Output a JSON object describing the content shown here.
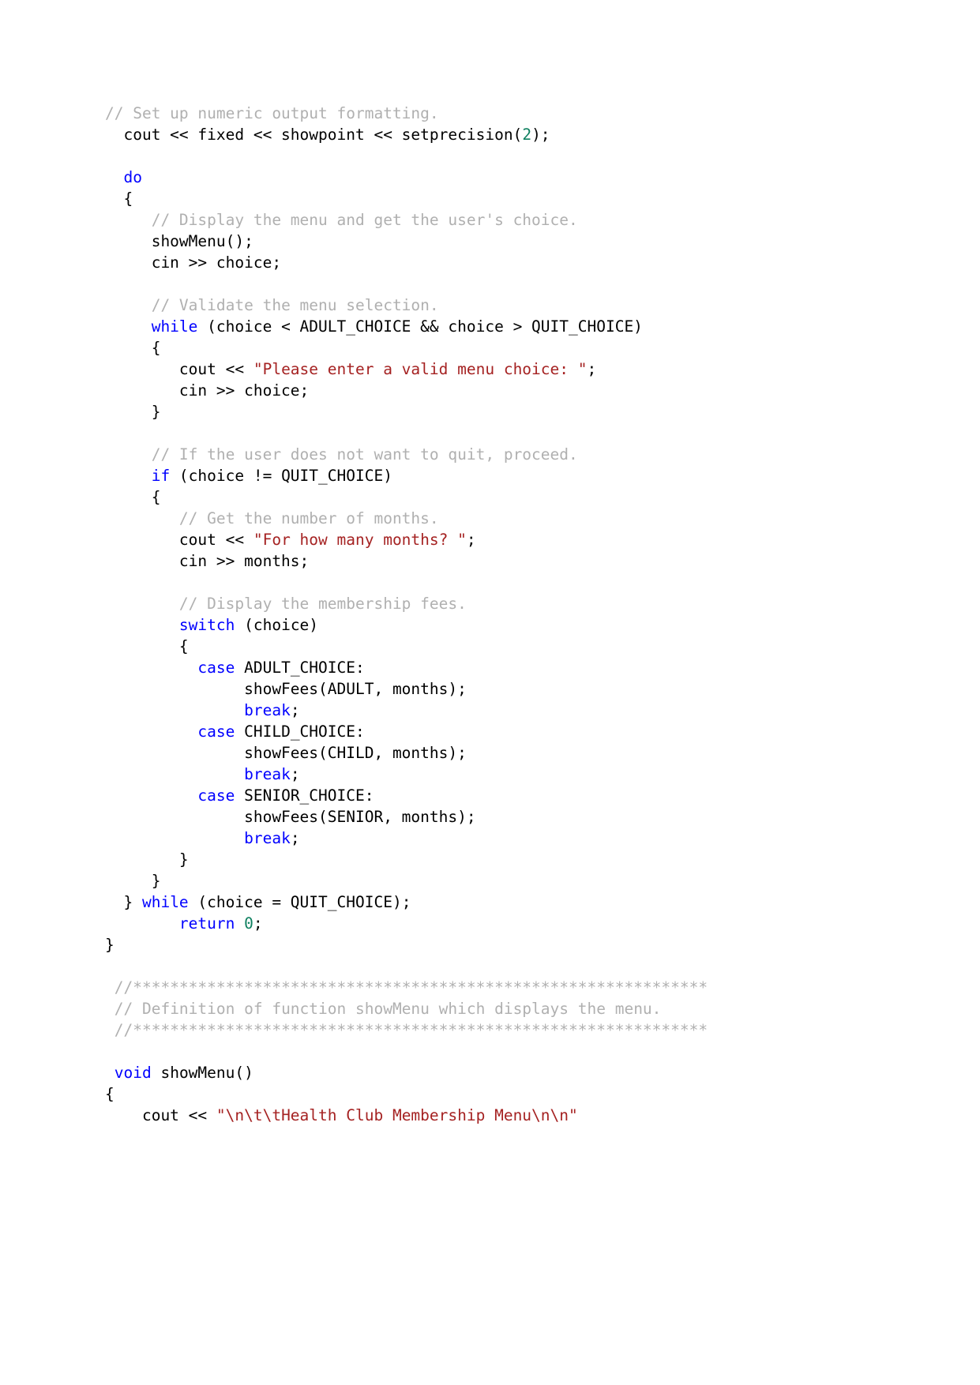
{
  "document": {
    "kind": "source-code-listing",
    "language": "C++",
    "background_color": "#ffffff"
  },
  "colors": {
    "plain": "#000000",
    "keyword": "#0000ff",
    "comment": "#b0b0b0",
    "string": "#a52222",
    "number": "#0f8060"
  },
  "code": {
    "lines": [
      {
        "tokens": [
          {
            "t": "comment",
            "s": "// Set up numeric output formatting."
          }
        ]
      },
      {
        "tokens": [
          {
            "t": "plain",
            "s": "  cout << fixed << showpoint << setprecision("
          },
          {
            "t": "number",
            "s": "2"
          },
          {
            "t": "plain",
            "s": ");"
          }
        ]
      },
      {
        "tokens": [
          {
            "t": "plain",
            "s": ""
          }
        ]
      },
      {
        "tokens": [
          {
            "t": "plain",
            "s": "  "
          },
          {
            "t": "keyword",
            "s": "do"
          }
        ]
      },
      {
        "tokens": [
          {
            "t": "plain",
            "s": "  {"
          }
        ]
      },
      {
        "tokens": [
          {
            "t": "plain",
            "s": "     "
          },
          {
            "t": "comment",
            "s": "// Display the menu and get the user's choice."
          }
        ]
      },
      {
        "tokens": [
          {
            "t": "plain",
            "s": "     showMenu();"
          }
        ]
      },
      {
        "tokens": [
          {
            "t": "plain",
            "s": "     cin >> choice;"
          }
        ]
      },
      {
        "tokens": [
          {
            "t": "plain",
            "s": ""
          }
        ]
      },
      {
        "tokens": [
          {
            "t": "plain",
            "s": "     "
          },
          {
            "t": "comment",
            "s": "// Validate the menu selection."
          }
        ]
      },
      {
        "tokens": [
          {
            "t": "plain",
            "s": "     "
          },
          {
            "t": "keyword",
            "s": "while"
          },
          {
            "t": "plain",
            "s": " (choice < ADULT_CHOICE && choice > QUIT_CHOICE)"
          }
        ]
      },
      {
        "tokens": [
          {
            "t": "plain",
            "s": "     {"
          }
        ]
      },
      {
        "tokens": [
          {
            "t": "plain",
            "s": "        cout << "
          },
          {
            "t": "string",
            "s": "\"Please enter a valid menu choice: \""
          },
          {
            "t": "plain",
            "s": ";"
          }
        ]
      },
      {
        "tokens": [
          {
            "t": "plain",
            "s": "        cin >> choice;"
          }
        ]
      },
      {
        "tokens": [
          {
            "t": "plain",
            "s": "     }"
          }
        ]
      },
      {
        "tokens": [
          {
            "t": "plain",
            "s": ""
          }
        ]
      },
      {
        "tokens": [
          {
            "t": "plain",
            "s": "     "
          },
          {
            "t": "comment",
            "s": "// If the user does not want to quit, proceed."
          }
        ]
      },
      {
        "tokens": [
          {
            "t": "plain",
            "s": "     "
          },
          {
            "t": "keyword",
            "s": "if"
          },
          {
            "t": "plain",
            "s": " (choice != QUIT_CHOICE)"
          }
        ]
      },
      {
        "tokens": [
          {
            "t": "plain",
            "s": "     {"
          }
        ]
      },
      {
        "tokens": [
          {
            "t": "plain",
            "s": "        "
          },
          {
            "t": "comment",
            "s": "// Get the number of months."
          }
        ]
      },
      {
        "tokens": [
          {
            "t": "plain",
            "s": "        cout << "
          },
          {
            "t": "string",
            "s": "\"For how many months? \""
          },
          {
            "t": "plain",
            "s": ";"
          }
        ]
      },
      {
        "tokens": [
          {
            "t": "plain",
            "s": "        cin >> months;"
          }
        ]
      },
      {
        "tokens": [
          {
            "t": "plain",
            "s": ""
          }
        ]
      },
      {
        "tokens": [
          {
            "t": "plain",
            "s": "        "
          },
          {
            "t": "comment",
            "s": "// Display the membership fees."
          }
        ]
      },
      {
        "tokens": [
          {
            "t": "plain",
            "s": "        "
          },
          {
            "t": "keyword",
            "s": "switch"
          },
          {
            "t": "plain",
            "s": " (choice)"
          }
        ]
      },
      {
        "tokens": [
          {
            "t": "plain",
            "s": "        {"
          }
        ]
      },
      {
        "tokens": [
          {
            "t": "plain",
            "s": "          "
          },
          {
            "t": "keyword",
            "s": "case"
          },
          {
            "t": "plain",
            "s": " ADULT_CHOICE:"
          }
        ]
      },
      {
        "tokens": [
          {
            "t": "plain",
            "s": "               showFees(ADULT, months);"
          }
        ]
      },
      {
        "tokens": [
          {
            "t": "plain",
            "s": "               "
          },
          {
            "t": "keyword",
            "s": "break"
          },
          {
            "t": "plain",
            "s": ";"
          }
        ]
      },
      {
        "tokens": [
          {
            "t": "plain",
            "s": "          "
          },
          {
            "t": "keyword",
            "s": "case"
          },
          {
            "t": "plain",
            "s": " CHILD_CHOICE:"
          }
        ]
      },
      {
        "tokens": [
          {
            "t": "plain",
            "s": "               showFees(CHILD, months);"
          }
        ]
      },
      {
        "tokens": [
          {
            "t": "plain",
            "s": "               "
          },
          {
            "t": "keyword",
            "s": "break"
          },
          {
            "t": "plain",
            "s": ";"
          }
        ]
      },
      {
        "tokens": [
          {
            "t": "plain",
            "s": "          "
          },
          {
            "t": "keyword",
            "s": "case"
          },
          {
            "t": "plain",
            "s": " SENIOR_CHOICE:"
          }
        ]
      },
      {
        "tokens": [
          {
            "t": "plain",
            "s": "               showFees(SENIOR, months);"
          }
        ]
      },
      {
        "tokens": [
          {
            "t": "plain",
            "s": "               "
          },
          {
            "t": "keyword",
            "s": "break"
          },
          {
            "t": "plain",
            "s": ";"
          }
        ]
      },
      {
        "tokens": [
          {
            "t": "plain",
            "s": "        }"
          }
        ]
      },
      {
        "tokens": [
          {
            "t": "plain",
            "s": "     }"
          }
        ]
      },
      {
        "tokens": [
          {
            "t": "plain",
            "s": "  } "
          },
          {
            "t": "keyword",
            "s": "while"
          },
          {
            "t": "plain",
            "s": " (choice = QUIT_CHOICE);"
          }
        ]
      },
      {
        "tokens": [
          {
            "t": "plain",
            "s": "        "
          },
          {
            "t": "keyword",
            "s": "return"
          },
          {
            "t": "plain",
            "s": " "
          },
          {
            "t": "number",
            "s": "0"
          },
          {
            "t": "plain",
            "s": ";"
          }
        ]
      },
      {
        "tokens": [
          {
            "t": "plain",
            "s": "}"
          }
        ]
      },
      {
        "tokens": [
          {
            "t": "plain",
            "s": ""
          }
        ]
      },
      {
        "tokens": [
          {
            "t": "plain",
            "s": " "
          },
          {
            "t": "comment",
            "s": "//**************************************************************"
          }
        ]
      },
      {
        "tokens": [
          {
            "t": "plain",
            "s": " "
          },
          {
            "t": "comment",
            "s": "// Definition of function showMenu which displays the menu."
          }
        ]
      },
      {
        "tokens": [
          {
            "t": "plain",
            "s": " "
          },
          {
            "t": "comment",
            "s": "//**************************************************************"
          }
        ]
      },
      {
        "tokens": [
          {
            "t": "plain",
            "s": ""
          }
        ]
      },
      {
        "tokens": [
          {
            "t": "plain",
            "s": " "
          },
          {
            "t": "keyword",
            "s": "void"
          },
          {
            "t": "plain",
            "s": " showMenu()"
          }
        ]
      },
      {
        "tokens": [
          {
            "t": "plain",
            "s": "{"
          }
        ]
      },
      {
        "tokens": [
          {
            "t": "plain",
            "s": "    cout << "
          },
          {
            "t": "string",
            "s": "\"\\n\\t\\tHealth Club Membership Menu\\n\\n\""
          }
        ]
      }
    ]
  }
}
